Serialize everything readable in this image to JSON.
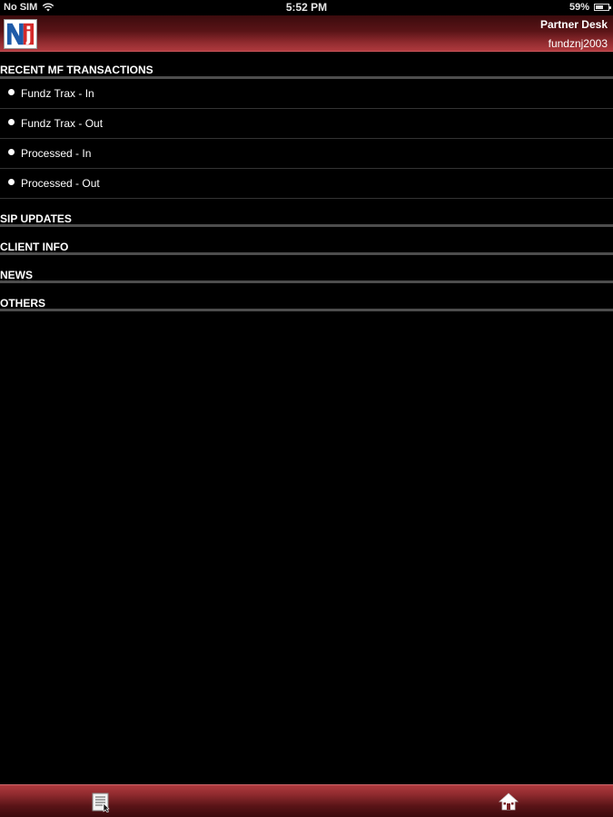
{
  "status_bar": {
    "carrier": "No SIM",
    "time": "5:52 PM",
    "battery_percent": "59%",
    "battery_level": 0.59
  },
  "header": {
    "title": "Partner Desk",
    "username": "fundznj2003",
    "logo_icon": "nj-logo"
  },
  "menu": {
    "recent_mf": {
      "label": "RECENT MF TRANSACTIONS",
      "items": [
        {
          "label": "Fundz Trax - In"
        },
        {
          "label": "Fundz Trax - Out"
        },
        {
          "label": "Processed - In"
        },
        {
          "label": "Processed - Out"
        }
      ]
    },
    "sip_updates": "SIP UPDATES",
    "client_info": "CLIENT INFO",
    "news": "NEWS",
    "others": "OTHERS"
  },
  "toolbar": {
    "left_icon": "document-icon",
    "right_icon": "home-icon"
  },
  "colors": {
    "background": "#000000",
    "header_red": "#8e2a2e",
    "divider": "#4d4d4d"
  }
}
